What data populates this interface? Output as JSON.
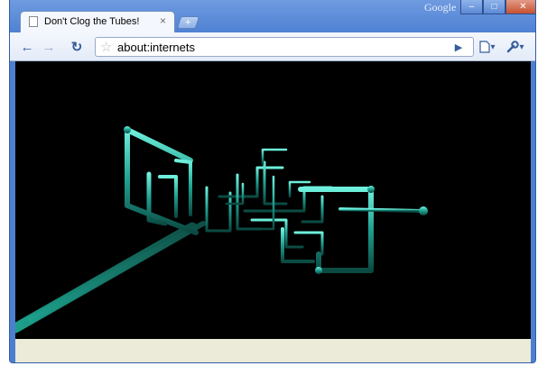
{
  "window": {
    "brand": "Google"
  },
  "tab": {
    "title": "Don't Clog the Tubes!",
    "close_glyph": "×"
  },
  "new_tab": {
    "glyph": "+"
  },
  "window_controls": {
    "minimize": "–",
    "maximize": "□",
    "close": "✕"
  },
  "toolbar": {
    "back_glyph": "←",
    "forward_glyph": "→",
    "reload_glyph": "↻",
    "go_glyph": "▶",
    "page_menu_glyph": "▾",
    "wrench_menu_glyph": "▾"
  },
  "omnibox": {
    "url": "about:internets",
    "star_glyph": "☆"
  },
  "content": {
    "description_colors": {
      "background": "#000000",
      "pipe": "#1f9e8e",
      "pipe_highlight": "#5fe0cf"
    }
  },
  "icons": [
    "page-icon",
    "close-icon",
    "new-tab-icon",
    "back-icon",
    "forward-icon",
    "reload-icon",
    "star-icon",
    "go-icon",
    "page-menu-icon",
    "wrench-icon"
  ]
}
